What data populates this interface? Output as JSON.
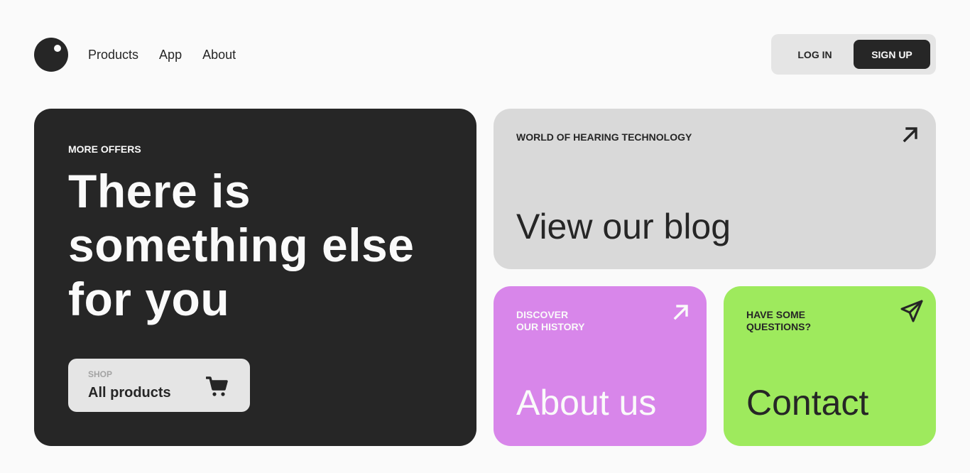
{
  "nav": {
    "items": [
      "Products",
      "App",
      "About"
    ]
  },
  "auth": {
    "login_label": "LOG IN",
    "signup_label": "SIGN UP"
  },
  "hero": {
    "eyebrow": "MORE OFFERS",
    "title": "There is something else for you",
    "shop": {
      "small_label": "SHOP",
      "label": "All products",
      "icon": "cart-icon"
    }
  },
  "blog": {
    "eyebrow": "WORLD OF HEARING TECHNOLOGY",
    "title": "View our blog",
    "icon": "arrow-up-right-icon"
  },
  "about": {
    "eyebrow_line1": "DISCOVER",
    "eyebrow_line2": "OUR HISTORY",
    "title": "About us",
    "icon": "arrow-up-right-icon"
  },
  "contact": {
    "eyebrow_line1": "HAVE SOME",
    "eyebrow_line2": "QUESTIONS?",
    "title": "Contact",
    "icon": "paper-plane-icon"
  },
  "colors": {
    "background": "#fafafa",
    "dark": "#262626",
    "blog_card": "#d9d9d9",
    "about_card": "#d886ea",
    "contact_card": "#9eea5d"
  }
}
